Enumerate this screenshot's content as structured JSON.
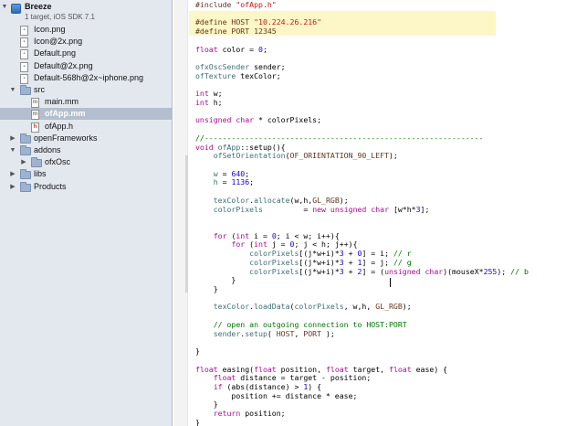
{
  "sidebar": {
    "project": {
      "name": "Breeze",
      "subtitle": "1 target, iOS SDK 7.1"
    },
    "items": [
      {
        "label": "Icon.png",
        "icon": "image-file-icon",
        "kind": "img",
        "depth": 1
      },
      {
        "label": "Icon@2x.png",
        "icon": "image-file-icon",
        "kind": "img",
        "depth": 1
      },
      {
        "label": "Default.png",
        "icon": "image-file-icon",
        "kind": "img",
        "depth": 1
      },
      {
        "label": "Default@2x.png",
        "icon": "image-file-icon",
        "kind": "img",
        "depth": 1
      },
      {
        "label": "Default-568h@2x~iphone.png",
        "icon": "image-file-icon",
        "kind": "img",
        "depth": 1
      },
      {
        "label": "src",
        "icon": "folder-icon",
        "kind": "folder",
        "depth": 1,
        "expanded": true
      },
      {
        "label": "main.mm",
        "icon": "source-file-icon",
        "kind": "m",
        "depth": 2
      },
      {
        "label": "ofApp.mm",
        "icon": "source-file-icon",
        "kind": "m",
        "depth": 2,
        "selected": true
      },
      {
        "label": "ofApp.h",
        "icon": "header-file-icon",
        "kind": "h",
        "depth": 2
      },
      {
        "label": "openFrameworks",
        "icon": "folder-icon",
        "kind": "folder",
        "depth": 1,
        "expanded": false
      },
      {
        "label": "addons",
        "icon": "folder-icon",
        "kind": "folder",
        "depth": 1,
        "expanded": true
      },
      {
        "label": "ofxOsc",
        "icon": "folder-icon",
        "kind": "folder",
        "depth": 2,
        "expanded": false
      },
      {
        "label": "libs",
        "icon": "folder-icon",
        "kind": "folder",
        "depth": 1,
        "expanded": false
      },
      {
        "label": "Products",
        "icon": "folder-icon",
        "kind": "folder",
        "depth": 1,
        "expanded": false
      }
    ]
  },
  "colors": {
    "keyword": "#aa0d91",
    "string": "#c41a16",
    "number": "#1c00cf",
    "comment": "#007400",
    "preprocessor": "#643820",
    "project_type": "#3f6e74",
    "macro": "#643820",
    "selection": "#b3bfcf",
    "define_highlight": "#fdf6c6"
  },
  "editor": {
    "file": "ofApp.mm",
    "lines": [
      [
        [
          "pp",
          "#include "
        ],
        [
          "str",
          "\"ofApp.h\""
        ]
      ],
      [],
      [
        [
          "pp",
          "#define HOST "
        ],
        [
          "str",
          "\"10.224.26.216\""
        ]
      ],
      [
        [
          "pp",
          "#define PORT 12345"
        ]
      ],
      [],
      [
        [
          "kw",
          "float"
        ],
        [
          "tx",
          " color = "
        ],
        [
          "num",
          "0"
        ],
        [
          "tx",
          ";"
        ]
      ],
      [],
      [
        [
          "ty",
          "ofxOscSender"
        ],
        [
          "tx",
          " sender;"
        ]
      ],
      [
        [
          "ty",
          "ofTexture"
        ],
        [
          "tx",
          " texColor;"
        ]
      ],
      [],
      [
        [
          "kw",
          "int"
        ],
        [
          "tx",
          " w;"
        ]
      ],
      [
        [
          "kw",
          "int"
        ],
        [
          "tx",
          " h;"
        ]
      ],
      [],
      [
        [
          "kw",
          "unsigned"
        ],
        [
          "tx",
          " "
        ],
        [
          "kw",
          "char"
        ],
        [
          "tx",
          " * colorPixels;"
        ]
      ],
      [],
      [
        [
          "cm",
          "//--------------------------------------------------------------"
        ]
      ],
      [
        [
          "kw",
          "void"
        ],
        [
          "tx",
          " "
        ],
        [
          "ty",
          "ofApp"
        ],
        [
          "tx",
          "::setup(){"
        ]
      ],
      [
        [
          "tx",
          "    "
        ],
        [
          "ty",
          "ofSetOrientation"
        ],
        [
          "tx",
          "("
        ],
        [
          "mc",
          "OF_ORIENTATION_90_LEFT"
        ],
        [
          "tx",
          ");"
        ]
      ],
      [],
      [
        [
          "tx",
          "    "
        ],
        [
          "ty",
          "w"
        ],
        [
          "tx",
          " = "
        ],
        [
          "num",
          "640"
        ],
        [
          "tx",
          ";"
        ]
      ],
      [
        [
          "tx",
          "    "
        ],
        [
          "ty",
          "h"
        ],
        [
          "tx",
          " = "
        ],
        [
          "num",
          "1136"
        ],
        [
          "tx",
          ";"
        ]
      ],
      [],
      [
        [
          "tx",
          "    "
        ],
        [
          "ty",
          "texColor"
        ],
        [
          "tx",
          "."
        ],
        [
          "ty",
          "allocate"
        ],
        [
          "tx",
          "(w,h,"
        ],
        [
          "mc",
          "GL_RGB"
        ],
        [
          "tx",
          ");"
        ]
      ],
      [
        [
          "tx",
          "    "
        ],
        [
          "ty",
          "colorPixels"
        ],
        [
          "tx",
          "         = "
        ],
        [
          "kw",
          "new"
        ],
        [
          "tx",
          " "
        ],
        [
          "kw",
          "unsigned"
        ],
        [
          "tx",
          " "
        ],
        [
          "kw",
          "char"
        ],
        [
          "tx",
          " [w*h*"
        ],
        [
          "num",
          "3"
        ],
        [
          "tx",
          "];"
        ]
      ],
      [],
      [],
      [
        [
          "tx",
          "    "
        ],
        [
          "kw",
          "for"
        ],
        [
          "tx",
          " ("
        ],
        [
          "kw",
          "int"
        ],
        [
          "tx",
          " i = "
        ],
        [
          "num",
          "0"
        ],
        [
          "tx",
          "; i < w; i++){"
        ]
      ],
      [
        [
          "tx",
          "        "
        ],
        [
          "kw",
          "for"
        ],
        [
          "tx",
          " ("
        ],
        [
          "kw",
          "int"
        ],
        [
          "tx",
          " j = "
        ],
        [
          "num",
          "0"
        ],
        [
          "tx",
          "; j < h; j++){"
        ]
      ],
      [
        [
          "tx",
          "            "
        ],
        [
          "ty",
          "colorPixels"
        ],
        [
          "tx",
          "[(j*w+i)*"
        ],
        [
          "num",
          "3"
        ],
        [
          "tx",
          " + "
        ],
        [
          "num",
          "0"
        ],
        [
          "tx",
          "] = i; "
        ],
        [
          "cm",
          "// r"
        ]
      ],
      [
        [
          "tx",
          "            "
        ],
        [
          "ty",
          "colorPixels"
        ],
        [
          "tx",
          "[(j*w+i)*"
        ],
        [
          "num",
          "3"
        ],
        [
          "tx",
          " + "
        ],
        [
          "num",
          "1"
        ],
        [
          "tx",
          "] = j; "
        ],
        [
          "cm",
          "// g"
        ]
      ],
      [
        [
          "tx",
          "            "
        ],
        [
          "ty",
          "colorPixels"
        ],
        [
          "tx",
          "[(j*w+i)*"
        ],
        [
          "num",
          "3"
        ],
        [
          "tx",
          " + "
        ],
        [
          "num",
          "2"
        ],
        [
          "tx",
          "] = ("
        ],
        [
          "kw",
          "unsigned"
        ],
        [
          "tx",
          " "
        ],
        [
          "kw",
          "char"
        ],
        [
          "tx",
          ")(mouseX*"
        ],
        [
          "num",
          "255"
        ],
        [
          "tx",
          "); "
        ],
        [
          "cm",
          "// b"
        ]
      ],
      [
        [
          "tx",
          "        }"
        ]
      ],
      [
        [
          "tx",
          "    }"
        ]
      ],
      [],
      [
        [
          "tx",
          "    "
        ],
        [
          "ty",
          "texColor"
        ],
        [
          "tx",
          "."
        ],
        [
          "ty",
          "loadData"
        ],
        [
          "tx",
          "("
        ],
        [
          "ty",
          "colorPixels"
        ],
        [
          "tx",
          ", w,h, "
        ],
        [
          "mc",
          "GL_RGB"
        ],
        [
          "tx",
          ");"
        ]
      ],
      [],
      [
        [
          "tx",
          "    "
        ],
        [
          "cm",
          "// open an outgoing connection to HOST:PORT"
        ]
      ],
      [
        [
          "tx",
          "    "
        ],
        [
          "ty",
          "sender"
        ],
        [
          "tx",
          "."
        ],
        [
          "ty",
          "setup"
        ],
        [
          "tx",
          "( "
        ],
        [
          "mc",
          "HOST"
        ],
        [
          "tx",
          ", "
        ],
        [
          "mc",
          "PORT"
        ],
        [
          "tx",
          " );"
        ]
      ],
      [],
      [
        [
          "tx",
          "}"
        ]
      ],
      [],
      [
        [
          "kw",
          "float"
        ],
        [
          "tx",
          " easing("
        ],
        [
          "kw",
          "float"
        ],
        [
          "tx",
          " position, "
        ],
        [
          "kw",
          "float"
        ],
        [
          "tx",
          " target, "
        ],
        [
          "kw",
          "float"
        ],
        [
          "tx",
          " ease) {"
        ]
      ],
      [
        [
          "tx",
          "    "
        ],
        [
          "kw",
          "float"
        ],
        [
          "tx",
          " distance = target - position;"
        ]
      ],
      [
        [
          "tx",
          "    "
        ],
        [
          "kw",
          "if"
        ],
        [
          "tx",
          " (abs(distance) > "
        ],
        [
          "num",
          "1"
        ],
        [
          "tx",
          ") {"
        ]
      ],
      [
        [
          "tx",
          "        position += distance * ease;"
        ]
      ],
      [
        [
          "tx",
          "    }"
        ]
      ],
      [
        [
          "tx",
          "    "
        ],
        [
          "kw",
          "return"
        ],
        [
          "tx",
          " position;"
        ]
      ],
      [
        [
          "tx",
          "}"
        ]
      ]
    ]
  }
}
